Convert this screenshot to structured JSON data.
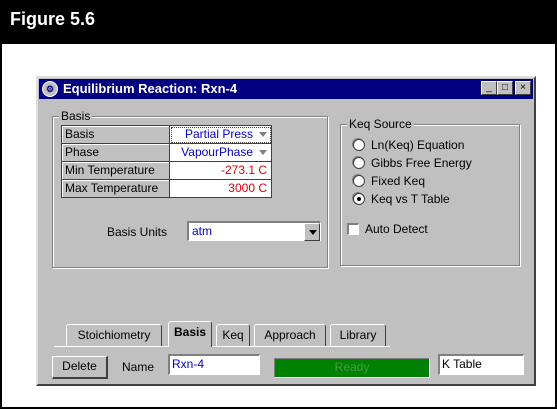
{
  "figure": {
    "title": "Figure 5.6"
  },
  "window": {
    "title": "Equilibrium Reaction: Rxn-4",
    "controls": {
      "minimize": "_",
      "maximize": "□",
      "close": "×"
    }
  },
  "basis_group": {
    "label": "Basis",
    "rows": [
      {
        "name": "Basis",
        "value": "Partial Press",
        "has_dropdown": true
      },
      {
        "name": "Phase",
        "value": "VapourPhase",
        "has_dropdown": true
      },
      {
        "name": "Min Temperature",
        "value": "-273.1 C"
      },
      {
        "name": "Max Temperature",
        "value": "3000 C"
      }
    ],
    "units_label": "Basis Units",
    "units_value": "atm"
  },
  "keq_source": {
    "label": "Keq Source",
    "options": [
      {
        "label": "Ln(Keq) Equation",
        "checked": false
      },
      {
        "label": "Gibbs Free Energy",
        "checked": false
      },
      {
        "label": "Fixed Keq",
        "checked": false
      },
      {
        "label": "Keq vs T Table",
        "checked": true
      }
    ],
    "auto_detect_label": "Auto Detect",
    "auto_detect_checked": false
  },
  "tabs": [
    "Stoichiometry",
    "Basis",
    "Keq",
    "Approach",
    "Library"
  ],
  "active_tab": "Basis",
  "footer": {
    "delete_label": "Delete",
    "name_label": "Name",
    "name_value": "Rxn-4",
    "status": "Ready",
    "status_color": "#008000",
    "table_field": "K Table"
  },
  "colors": {
    "title_bar": "#000080",
    "face": "#c0c0c0",
    "value_blue": "#0000d0",
    "value_red": "#e00000"
  }
}
